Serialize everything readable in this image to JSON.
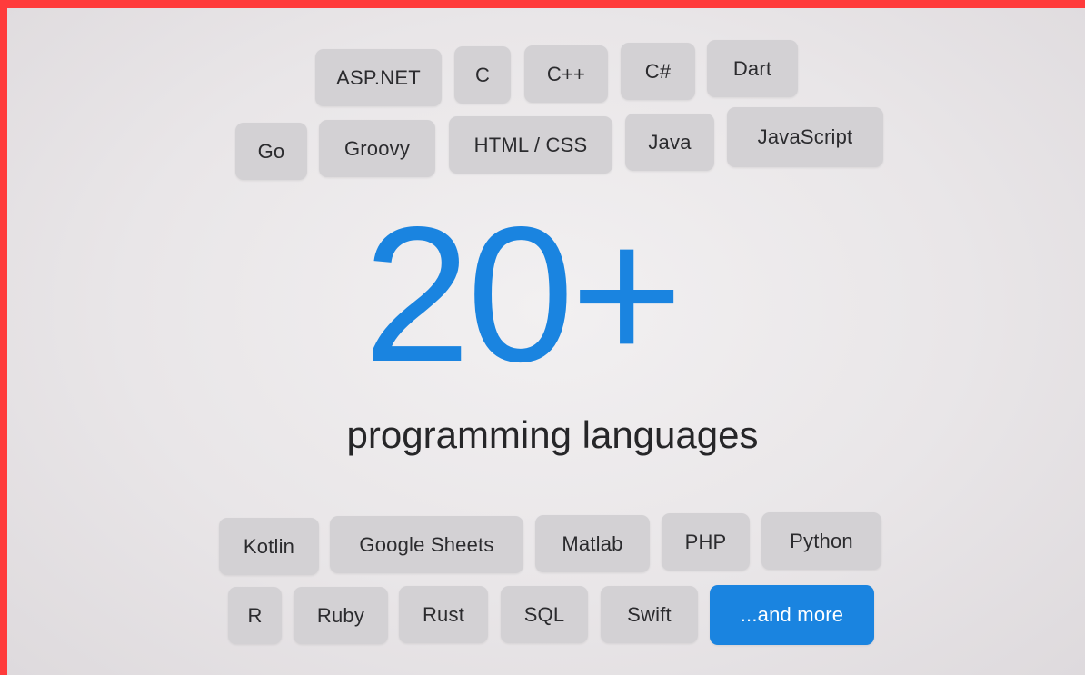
{
  "colors": {
    "frame_border": "#ff3b3b",
    "accent": "#1a84e0",
    "chip_background": "#d3d1d4",
    "text_dark": "#2b2b2e"
  },
  "headline": {
    "number": "20+",
    "subtitle": "programming languages"
  },
  "chips_top_row1": [
    "ASP.NET",
    "C",
    "C++",
    "C#",
    "Dart"
  ],
  "chips_top_row2": [
    "Go",
    "Groovy",
    "HTML / CSS",
    "Java",
    "JavaScript"
  ],
  "chips_bottom_row1": [
    "Kotlin",
    "Google Sheets",
    "Matlab",
    "PHP",
    "Python"
  ],
  "chips_bottom_row2": [
    "R",
    "Ruby",
    "Rust",
    "SQL",
    "Swift",
    "...and more"
  ]
}
